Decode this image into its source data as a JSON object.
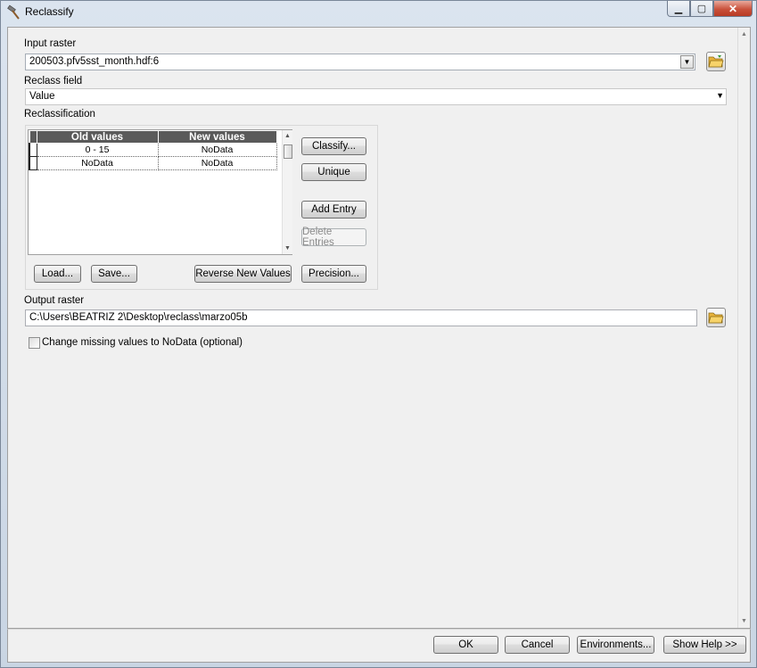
{
  "window": {
    "title": "Reclassify",
    "minimize_glyph": "▁",
    "maximize_glyph": "▢",
    "close_glyph": "✕"
  },
  "input_raster": {
    "label": "Input raster",
    "value": "200503.pfv5sst_month.hdf:6"
  },
  "reclass_field": {
    "label": "Reclass field",
    "value": "Value"
  },
  "reclassification": {
    "label": "Reclassification",
    "columns": [
      "Old values",
      "New values"
    ],
    "rows": [
      {
        "old": "0 - 15",
        "new": "NoData"
      },
      {
        "old": "NoData",
        "new": "NoData"
      }
    ],
    "buttons": {
      "classify": "Classify...",
      "unique": "Unique",
      "add_entry": "Add Entry",
      "delete_entries": "Delete Entries",
      "load": "Load...",
      "save": "Save...",
      "reverse": "Reverse New Values",
      "precision": "Precision..."
    }
  },
  "output_raster": {
    "label": "Output raster",
    "value": "C:\\Users\\BEATRIZ 2\\Desktop\\reclass\\marzo05b"
  },
  "change_missing": {
    "label": "Change missing values to NoData (optional)",
    "checked": false
  },
  "footer": {
    "ok": "OK",
    "cancel": "Cancel",
    "environments": "Environments...",
    "show_help": "Show Help >>"
  }
}
